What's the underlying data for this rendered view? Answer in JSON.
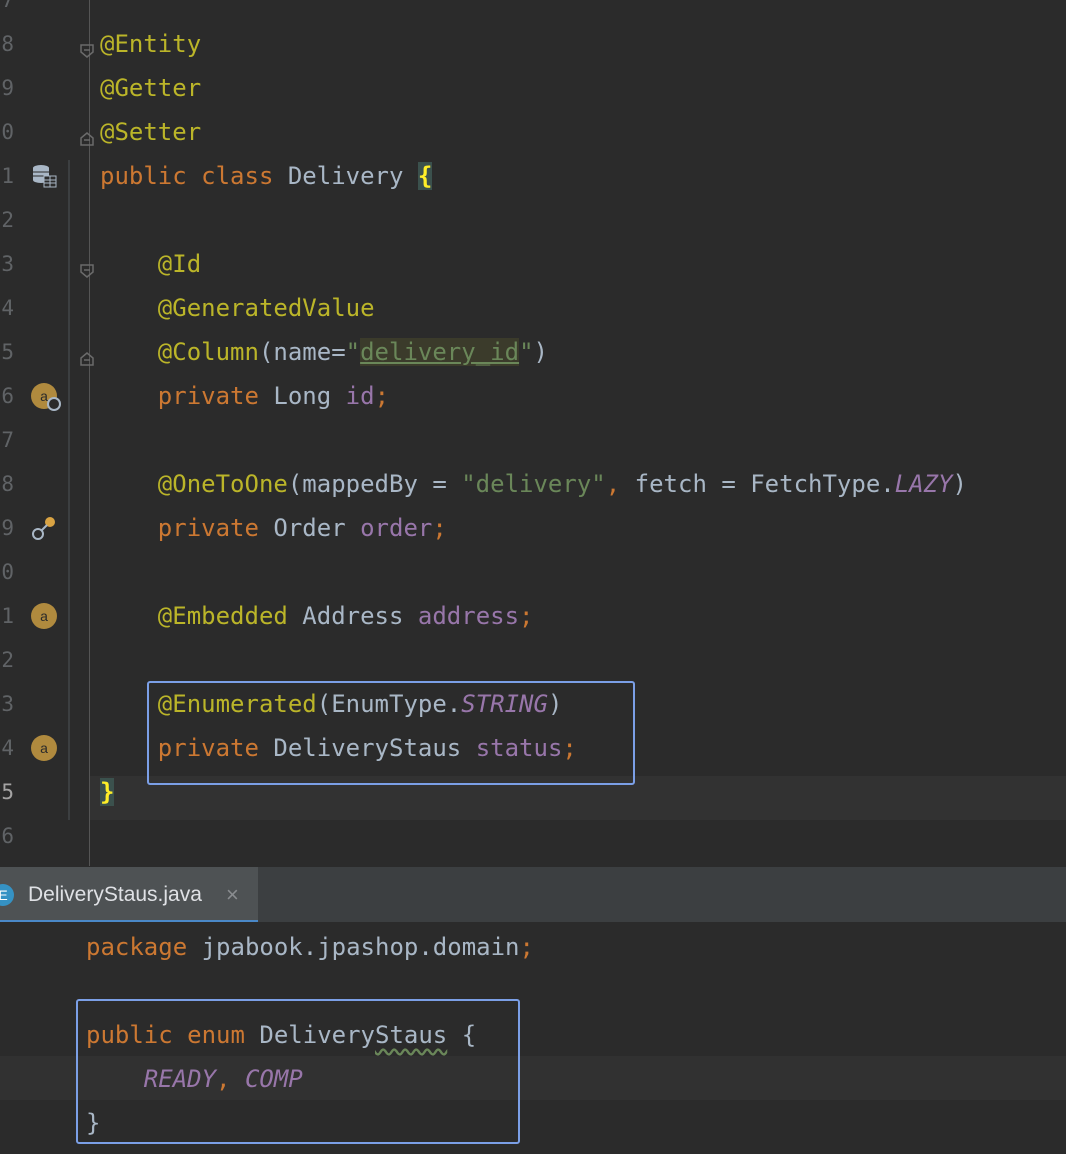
{
  "editor_top": {
    "lines": [
      {
        "num": "7",
        "tokens": []
      },
      {
        "num": "8",
        "tokens": [
          {
            "t": "@Entity",
            "c": "ann"
          }
        ]
      },
      {
        "num": "9",
        "tokens": [
          {
            "t": "@Getter",
            "c": "ann"
          }
        ]
      },
      {
        "num": "0",
        "tokens": [
          {
            "t": "@Setter",
            "c": "ann"
          }
        ]
      },
      {
        "num": "1",
        "tokens": [
          {
            "t": "public",
            "c": "kw"
          },
          {
            "t": " ",
            "c": "plain"
          },
          {
            "t": "class",
            "c": "kw"
          },
          {
            "t": " Delivery ",
            "c": "plain"
          },
          {
            "t": "{",
            "c": "brace-hl"
          }
        ]
      },
      {
        "num": "2",
        "tokens": []
      },
      {
        "num": "3",
        "tokens": [
          {
            "t": "    ",
            "c": "plain"
          },
          {
            "t": "@Id",
            "c": "ann"
          }
        ]
      },
      {
        "num": "4",
        "tokens": [
          {
            "t": "    ",
            "c": "plain"
          },
          {
            "t": "@GeneratedValue",
            "c": "ann"
          }
        ]
      },
      {
        "num": "5",
        "tokens": [
          {
            "t": "    ",
            "c": "plain"
          },
          {
            "t": "@Column",
            "c": "ann"
          },
          {
            "t": "(name=",
            "c": "plain"
          },
          {
            "t": "\"",
            "c": "str"
          },
          {
            "t": "delivery_id",
            "c": "str str-hl"
          },
          {
            "t": "\"",
            "c": "str"
          },
          {
            "t": ")",
            "c": "plain"
          }
        ]
      },
      {
        "num": "6",
        "tokens": [
          {
            "t": "    ",
            "c": "plain"
          },
          {
            "t": "private",
            "c": "kw"
          },
          {
            "t": " Long ",
            "c": "plain"
          },
          {
            "t": "id",
            "c": "field"
          },
          {
            "t": ";",
            "c": "punc"
          }
        ]
      },
      {
        "num": "7",
        "tokens": []
      },
      {
        "num": "8",
        "tokens": [
          {
            "t": "    ",
            "c": "plain"
          },
          {
            "t": "@OneToOne",
            "c": "ann"
          },
          {
            "t": "(mappedBy = ",
            "c": "plain"
          },
          {
            "t": "\"delivery\"",
            "c": "str"
          },
          {
            "t": ", ",
            "c": "punc"
          },
          {
            "t": "fetch = FetchType.",
            "c": "plain"
          },
          {
            "t": "LAZY",
            "c": "konst"
          },
          {
            "t": ")",
            "c": "plain"
          }
        ]
      },
      {
        "num": "9",
        "tokens": [
          {
            "t": "    ",
            "c": "plain"
          },
          {
            "t": "private",
            "c": "kw"
          },
          {
            "t": " Order ",
            "c": "plain"
          },
          {
            "t": "order",
            "c": "field"
          },
          {
            "t": ";",
            "c": "punc"
          }
        ]
      },
      {
        "num": "0",
        "tokens": []
      },
      {
        "num": "1",
        "tokens": [
          {
            "t": "    ",
            "c": "plain"
          },
          {
            "t": "@Embedded",
            "c": "ann"
          },
          {
            "t": " Address ",
            "c": "plain"
          },
          {
            "t": "address",
            "c": "field"
          },
          {
            "t": ";",
            "c": "punc"
          }
        ]
      },
      {
        "num": "2",
        "tokens": []
      },
      {
        "num": "3",
        "tokens": [
          {
            "t": "    ",
            "c": "plain"
          },
          {
            "t": "@Enumerated",
            "c": "ann"
          },
          {
            "t": "(EnumType.",
            "c": "plain"
          },
          {
            "t": "STRING",
            "c": "konst"
          },
          {
            "t": ")",
            "c": "plain"
          }
        ]
      },
      {
        "num": "4",
        "tokens": [
          {
            "t": "    ",
            "c": "plain"
          },
          {
            "t": "private",
            "c": "kw"
          },
          {
            "t": " DeliveryStaus ",
            "c": "plain"
          },
          {
            "t": "status",
            "c": "field"
          },
          {
            "t": ";",
            "c": "punc"
          }
        ]
      },
      {
        "num": "5",
        "tokens": [
          {
            "t": "}",
            "c": "brace-hl"
          }
        ]
      },
      {
        "num": "6",
        "tokens": []
      }
    ],
    "gutter_icons": [
      {
        "line_index": 4,
        "icon": "database-table-icon"
      },
      {
        "line_index": 9,
        "icon": "attribute-key-icon",
        "label": "a"
      },
      {
        "line_index": 12,
        "icon": "relation-link-icon"
      },
      {
        "line_index": 14,
        "icon": "attribute-icon",
        "label": "a"
      },
      {
        "line_index": 17,
        "icon": "attribute-icon",
        "label": "a"
      }
    ]
  },
  "tab": {
    "icon_letter": "E",
    "label": "DeliveryStaus.java",
    "close_glyph": "×"
  },
  "editor_bottom": {
    "lines": [
      {
        "tokens": [
          {
            "t": "package",
            "c": "kw"
          },
          {
            "t": " jpabook.jpashop.domain",
            "c": "plain"
          },
          {
            "t": ";",
            "c": "punc"
          }
        ]
      },
      {
        "tokens": []
      },
      {
        "tokens": [
          {
            "t": "public",
            "c": "kw"
          },
          {
            "t": " ",
            "c": "plain"
          },
          {
            "t": "enum",
            "c": "kw"
          },
          {
            "t": " Delivery",
            "c": "plain"
          },
          {
            "t": "Staus",
            "c": "plain squiggle"
          },
          {
            "t": " {",
            "c": "plain"
          }
        ]
      },
      {
        "tokens": [
          {
            "t": "    ",
            "c": "plain"
          },
          {
            "t": "READY",
            "c": "konst"
          },
          {
            "t": ", ",
            "c": "punc"
          },
          {
            "t": "COMP",
            "c": "konst"
          }
        ]
      },
      {
        "tokens": [
          {
            "t": "}",
            "c": "plain"
          }
        ]
      }
    ]
  },
  "colors": {
    "background": "#2b2b2b",
    "annotation": "#bbb529",
    "keyword": "#cc7832",
    "field": "#9876aa",
    "string": "#6a8759",
    "highlight_box": "#7b9fe6"
  }
}
